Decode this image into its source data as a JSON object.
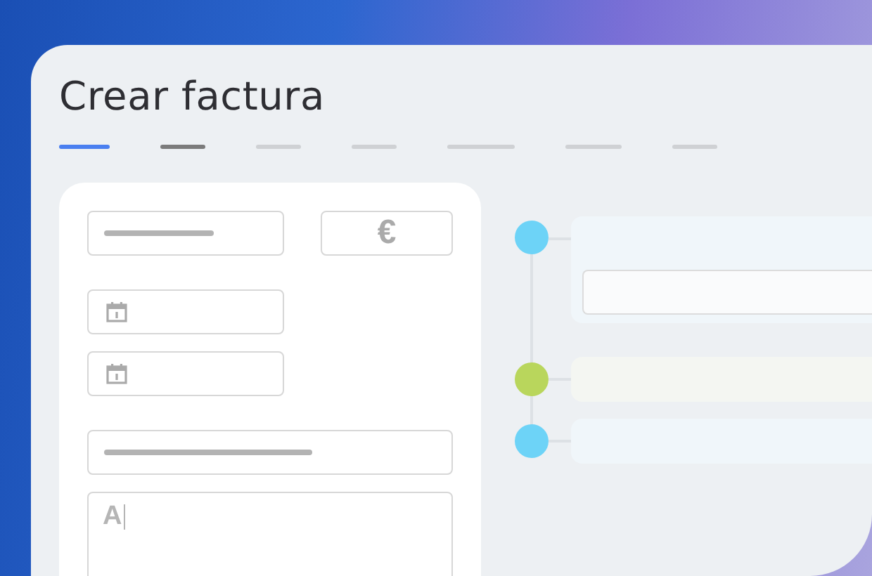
{
  "title": "Crear factura",
  "steps": [
    {
      "kind": "active"
    },
    {
      "kind": "visited"
    },
    {
      "kind": "pending"
    },
    {
      "kind": "pending"
    },
    {
      "kind": "pending"
    },
    {
      "kind": "pending"
    },
    {
      "kind": "pending"
    }
  ],
  "form": {
    "groups": [
      {
        "kind": "row",
        "fields": [
          {
            "kind": "line"
          },
          {
            "kind": "currency",
            "symbol": "€"
          }
        ]
      },
      {
        "kind": "column",
        "fields": [
          {
            "kind": "date"
          },
          {
            "kind": "date"
          }
        ]
      },
      {
        "kind": "column",
        "fields": [
          {
            "kind": "line"
          },
          {
            "kind": "text",
            "value": "A"
          }
        ]
      }
    ]
  },
  "timeline": [
    {
      "kind": "input",
      "color": "#6dd3f7"
    },
    {
      "kind": "plain",
      "color": "#b9d65c"
    },
    {
      "kind": "plain",
      "color": "#6dd3f7"
    }
  ]
}
